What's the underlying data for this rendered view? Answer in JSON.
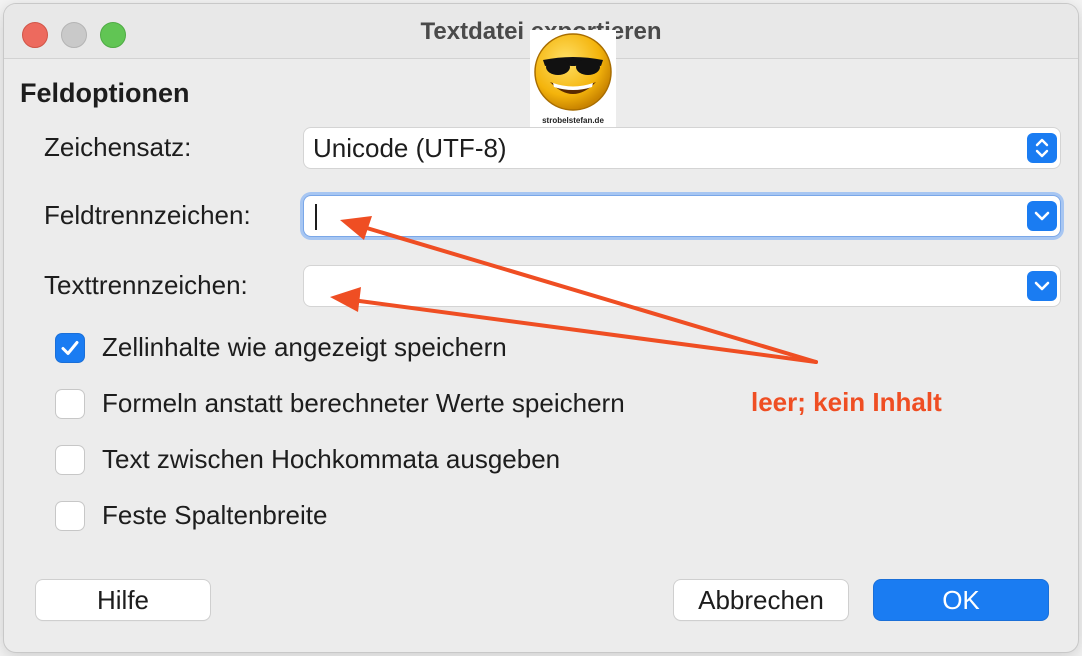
{
  "window": {
    "title": "Textdatei exportieren",
    "controls": [
      "close",
      "minimize",
      "maximize"
    ]
  },
  "watermark": {
    "caption": "strobelstefan.de"
  },
  "section": {
    "title": "Feldoptionen"
  },
  "fields": {
    "zeichensatz": {
      "label": "Zeichensatz:",
      "value": "Unicode (UTF-8)"
    },
    "feldtrennzeichen": {
      "label": "Feldtrennzeichen:",
      "value": ""
    },
    "texttrennzeichen": {
      "label": "Texttrennzeichen:",
      "value": ""
    }
  },
  "options": [
    {
      "label": "Zellinhalte wie angezeigt speichern",
      "checked": true
    },
    {
      "label": "Formeln anstatt berechneter Werte speichern",
      "checked": false
    },
    {
      "label": "Text zwischen Hochkommata ausgeben",
      "checked": false
    },
    {
      "label": "Feste Spaltenbreite",
      "checked": false
    }
  ],
  "buttons": {
    "help": "Hilfe",
    "cancel": "Abbrechen",
    "ok": "OK"
  },
  "annotation": {
    "text": "leer; kein Inhalt",
    "color": "#ef4e23"
  },
  "colors": {
    "accent": "#1a7cf2",
    "close": "#ed6a5e",
    "maximize": "#61c554"
  }
}
